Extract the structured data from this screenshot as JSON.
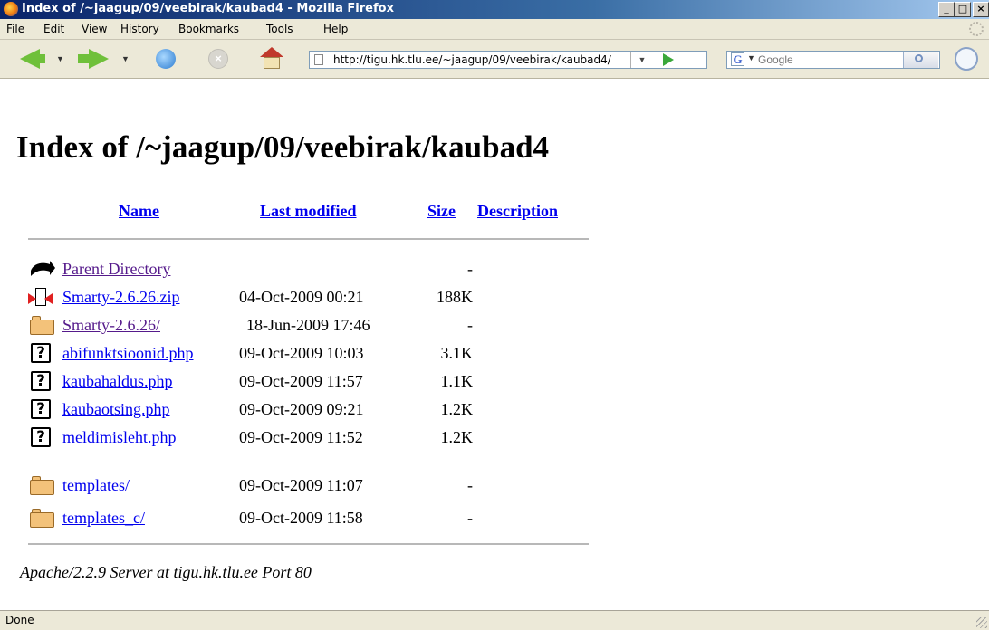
{
  "window": {
    "title": "Index of /~jaagup/09/veebirak/kaubad4 - Mozilla Firefox",
    "buttons": {
      "minimize": "_",
      "maximize": "□",
      "close": "×"
    }
  },
  "menu": [
    "File",
    "Edit",
    "View",
    "History",
    "Bookmarks",
    "Tools",
    "Help"
  ],
  "toolbar": {
    "url": "http://tigu.hk.tlu.ee/~jaagup/09/veebirak/kaubad4/",
    "search_placeholder": "Google",
    "search_engine_icon": "G"
  },
  "page": {
    "heading": "Index of /~jaagup/09/veebirak/kaubad4",
    "columns": {
      "name": "Name",
      "modified": "Last modified",
      "size": "Size",
      "description": "Description"
    },
    "entries": [
      {
        "icon": "back-icon",
        "name": "Parent Directory",
        "modified": "",
        "size": "-",
        "visited": true
      },
      {
        "icon": "compressed-icon",
        "name": "Smarty-2.6.26.zip",
        "modified": "04-Oct-2009 00:21",
        "size": "188K",
        "visited": false
      },
      {
        "icon": "folder-icon",
        "name": "Smarty-2.6.26/",
        "modified": "18-Jun-2009 17:46",
        "size": "-",
        "visited": true
      },
      {
        "icon": "unknown-file-icon",
        "name": "abifunktsioonid.php",
        "modified": "09-Oct-2009 10:03",
        "size": "3.1K",
        "visited": false
      },
      {
        "icon": "unknown-file-icon",
        "name": "kaubahaldus.php",
        "modified": "09-Oct-2009 11:57",
        "size": "1.1K",
        "visited": false
      },
      {
        "icon": "unknown-file-icon",
        "name": "kaubaotsing.php",
        "modified": "09-Oct-2009 09:21",
        "size": "1.2K",
        "visited": false
      },
      {
        "icon": "unknown-file-icon",
        "name": "meldimisleht.php",
        "modified": "09-Oct-2009 11:52",
        "size": "1.2K",
        "visited": false
      },
      {
        "icon": "folder-icon",
        "name": "templates/",
        "modified": "09-Oct-2009 11:07",
        "size": "-",
        "visited": false
      },
      {
        "icon": "folder-icon",
        "name": "templates_c/",
        "modified": "09-Oct-2009 11:58",
        "size": "-",
        "visited": false
      }
    ],
    "server_signature": "Apache/2.2.9 Server at tigu.hk.tlu.ee Port 80"
  },
  "status": {
    "text": "Done"
  },
  "colors": {
    "link": "#0000ee",
    "visited": "#551a8b",
    "chrome": "#ece9d8"
  }
}
